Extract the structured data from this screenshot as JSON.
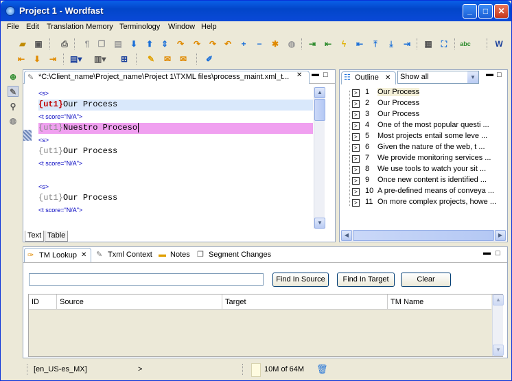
{
  "window": {
    "title": "Project 1 - Wordfast"
  },
  "menu": [
    "File",
    "Edit",
    "Translation Memory",
    "Terminology",
    "Window",
    "Help"
  ],
  "editor": {
    "tab_title": "*C:\\Client_name\\Project_name\\Project 1\\TXML files\\process_maint.xml_t...",
    "close_glyph": "✕",
    "lines": {
      "l1": "<s>",
      "l2_tag": "{ut1}",
      "l2_text": "Our Process",
      "l3": "<t score=\"N/A\">",
      "l4_tag": "{ut1}",
      "l4_text": "Nuestro Proceso",
      "l5": "<s>",
      "l6_tag": "{ut1}",
      "l6_text": "Our Process",
      "l7": "<t score=\"N/A\">",
      "l8": "<s>",
      "l9_tag": "{ut1}",
      "l9_text": "Our Process",
      "l10": "<t score=\"N/A\">"
    },
    "bottom_tabs": [
      "Text",
      "Table"
    ]
  },
  "outline": {
    "tab_label": "Outline",
    "filter_value": "Show all",
    "items": [
      {
        "num": "1",
        "text": "Our Process"
      },
      {
        "num": "2",
        "text": "Our Process"
      },
      {
        "num": "3",
        "text": "Our Process"
      },
      {
        "num": "4",
        "text": "One of the most popular questi ..."
      },
      {
        "num": "5",
        "text": "Most projects entail some leve ..."
      },
      {
        "num": "6",
        "text": "Given the nature of the web, t ..."
      },
      {
        "num": "7",
        "text": "We provide monitoring services ..."
      },
      {
        "num": "8",
        "text": "We use tools to watch your sit ..."
      },
      {
        "num": "9",
        "text": "Once new content is identified ..."
      },
      {
        "num": "10",
        "text": "A pre-defined means of conveya ..."
      },
      {
        "num": "11",
        "text": "On more complex projects, howe ..."
      }
    ]
  },
  "lower": {
    "tabs": [
      "TM Lookup",
      "Txml Context",
      "Notes",
      "Segment Changes"
    ],
    "search_value": "",
    "buttons": {
      "find_source": "Find In Source",
      "find_target": "Find In Target",
      "clear": "Clear"
    },
    "columns": [
      "ID",
      "Source",
      "Target",
      "TM Name"
    ]
  },
  "status": {
    "language": "[en_US-es_MX]",
    "arrow": ">",
    "memory": "10M of 64M"
  },
  "colors": {
    "titlebar": "#0a5fe8",
    "highlight_source": "#d9e8fb",
    "highlight_target": "#f0a0f0",
    "tag_color": "#0000c0",
    "ut_color": "#c00000"
  }
}
